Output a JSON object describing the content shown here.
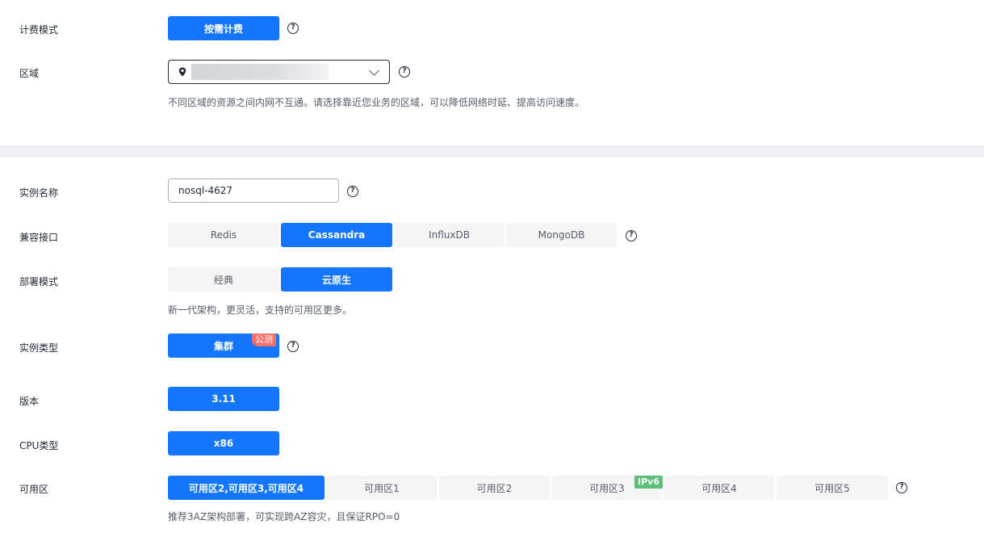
{
  "billing": {
    "label": "计费模式",
    "button": "按需计费"
  },
  "region": {
    "label": "区域",
    "hint": "不同区域的资源之间内网不互通。请选择靠近您业务的区域，可以降低网络时延、提高访问速度。"
  },
  "instance_name": {
    "label": "实例名称",
    "value": "nosql-4627"
  },
  "interface": {
    "label": "兼容接口",
    "options": [
      "Redis",
      "Cassandra",
      "InfluxDB",
      "MongoDB"
    ],
    "selected": "Cassandra"
  },
  "deploy": {
    "label": "部署模式",
    "options": [
      "经典",
      "云原生"
    ],
    "selected": "云原生",
    "hint": "新一代架构，更灵活，支持的可用区更多。"
  },
  "instance_type": {
    "label": "实例类型",
    "button": "集群",
    "badge": "公测"
  },
  "version": {
    "label": "版本",
    "button": "3.11"
  },
  "cpu": {
    "label": "CPU类型",
    "button": "x86"
  },
  "az": {
    "label": "可用区",
    "options": [
      "可用区2,可用区3,可用区4",
      "可用区1",
      "可用区2",
      "可用区3",
      "可用区4",
      "可用区5"
    ],
    "selected": "可用区2,可用区3,可用区4",
    "ipv6_badge": "IPv6",
    "hint": "推荐3AZ架构部署，可实现跨AZ容灾，且保证RPO=0"
  },
  "help_glyph": "?",
  "colors": {
    "primary": "#1476ff",
    "option_bg": "#f5f5f6",
    "badge_red": "#f66f6a",
    "badge_green": "#5cbe79",
    "divider": "#eef0f5"
  }
}
